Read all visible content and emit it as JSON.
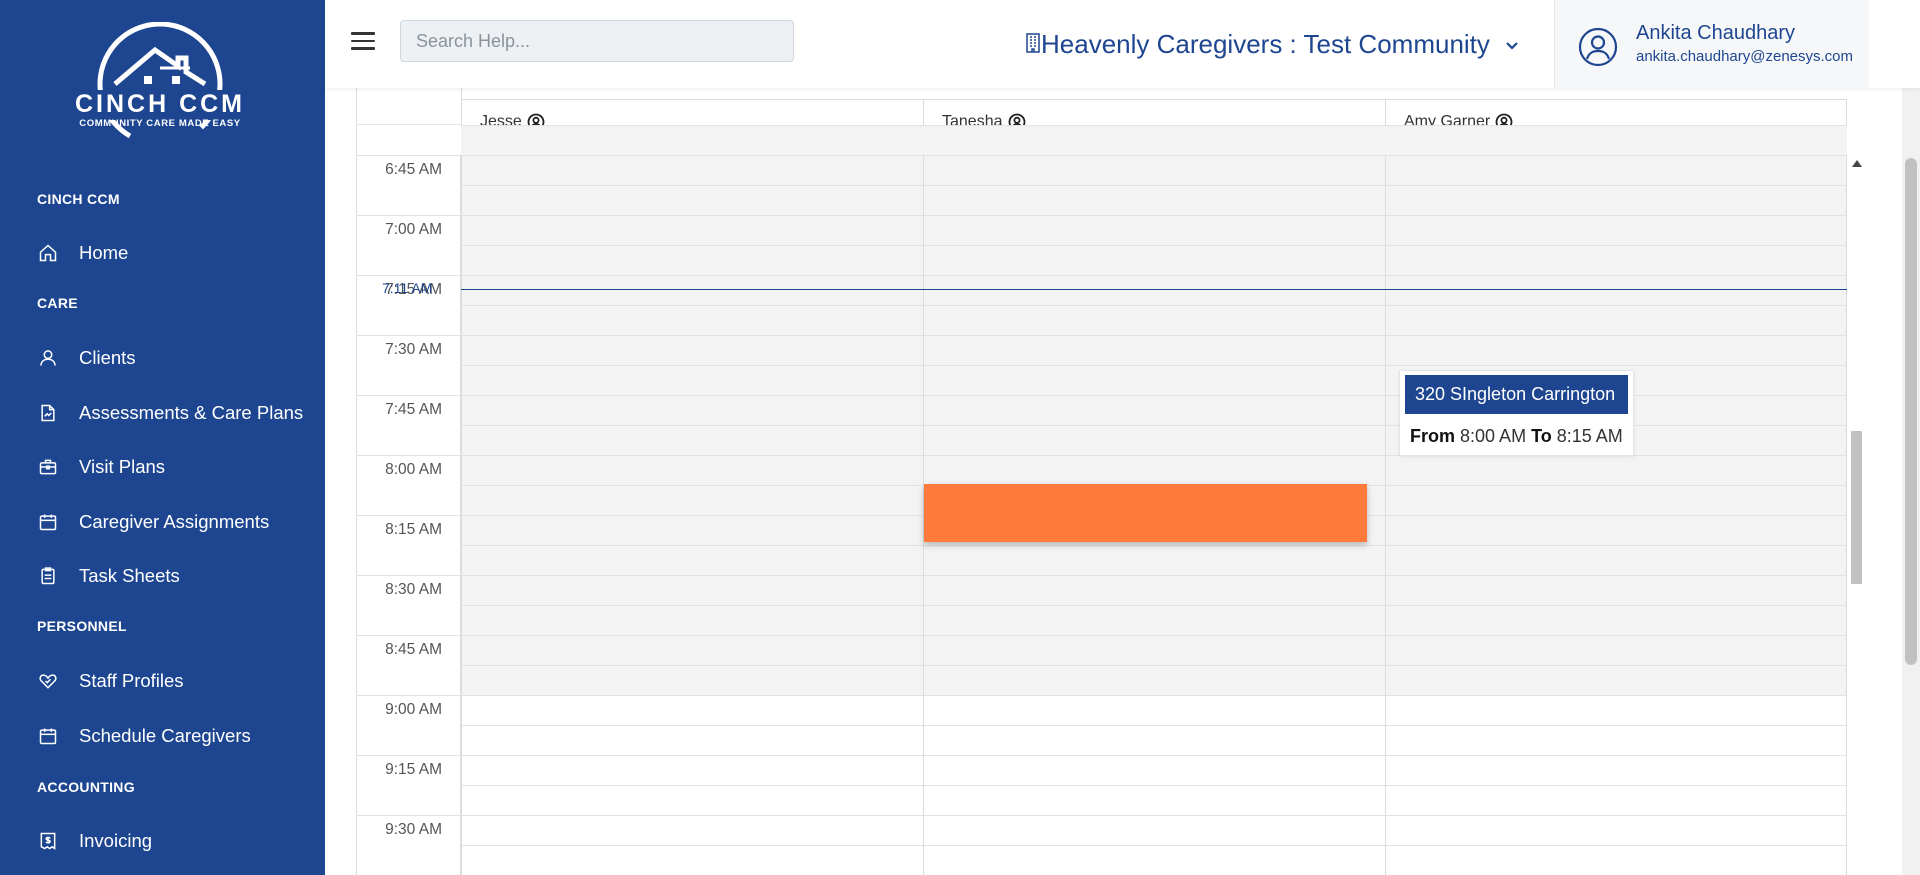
{
  "brand": {
    "logo_main": "CINCH CCM",
    "logo_tagline": "COMMUNITY CARE MADE EASY",
    "sidebar_color": "#1e4690",
    "accent_color": "#1e4690",
    "event_color": "#ff7a3b"
  },
  "sidebar": {
    "sections": [
      {
        "title": "CINCH CCM",
        "items": [
          {
            "label": "Home",
            "icon": "home-icon"
          }
        ]
      },
      {
        "title": "CARE",
        "items": [
          {
            "label": "Clients",
            "icon": "user-icon"
          },
          {
            "label": "Assessments & Care Plans",
            "icon": "document-icon"
          },
          {
            "label": "Visit Plans",
            "icon": "briefcase-icon"
          },
          {
            "label": "Caregiver Assignments",
            "icon": "calendar-icon"
          },
          {
            "label": "Task Sheets",
            "icon": "clipboard-icon"
          }
        ]
      },
      {
        "title": "PERSONNEL",
        "items": [
          {
            "label": "Staff Profiles",
            "icon": "heart-icon"
          },
          {
            "label": "Schedule Caregivers",
            "icon": "calendar-icon"
          }
        ]
      },
      {
        "title": "ACCOUNTING",
        "items": [
          {
            "label": "Invoicing",
            "icon": "invoice-icon"
          }
        ]
      }
    ]
  },
  "topbar": {
    "search_placeholder": "Search Help...",
    "community": "Heavenly Caregivers : Test Community",
    "user_name": "Ankita Chaudhary",
    "user_email": "ankita.chaudhary@zenesys.com"
  },
  "calendar": {
    "resources": [
      "Jesse",
      "Tanesha",
      "Amy Garner"
    ],
    "time_labels": [
      "6:45 AM",
      "7:00 AM",
      "7:15 AM",
      "7:30 AM",
      "7:45 AM",
      "8:00 AM",
      "8:15 AM",
      "8:30 AM",
      "8:45 AM",
      "9:00 AM",
      "9:15 AM",
      "9:30 AM"
    ],
    "current_time": "7:11 AM",
    "tooltip": {
      "title": "320 SIngleton Carrington",
      "from_label": "From",
      "from": "8:00 AM",
      "to_label": "To",
      "to": "8:15 AM"
    }
  }
}
